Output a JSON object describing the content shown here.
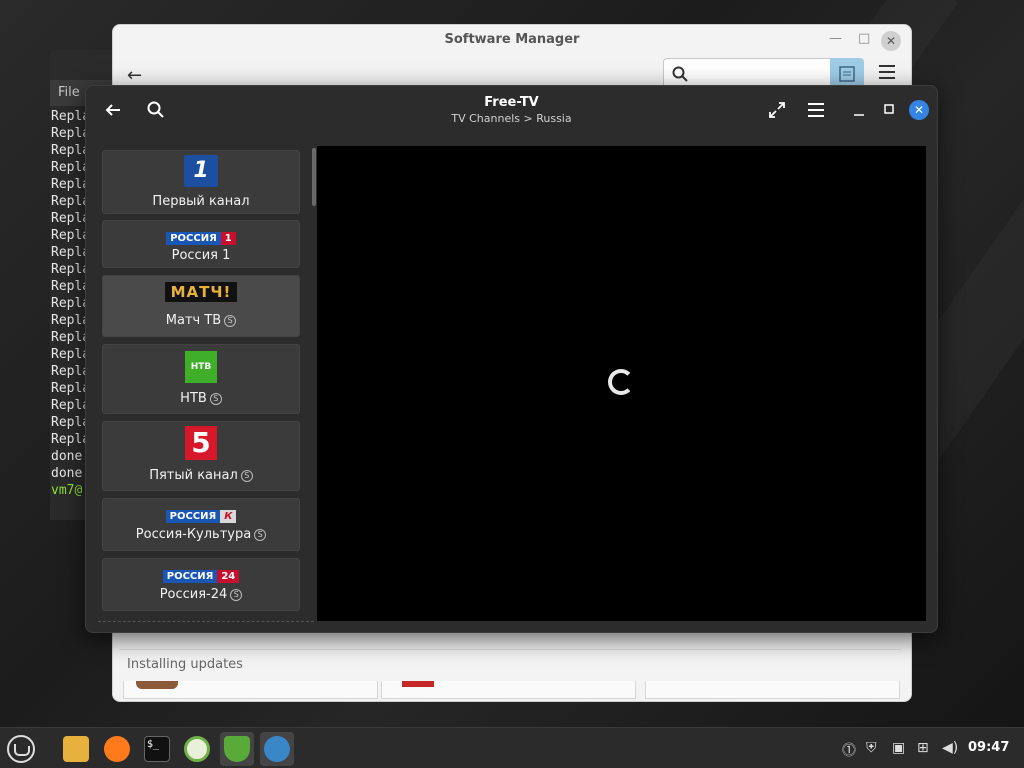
{
  "terminal": {
    "menu_label": "File",
    "lines": [
      "Repla",
      "Repla",
      "Repla",
      "Repla",
      "Repla",
      "Repla",
      "Repla",
      "Repla",
      "Repla",
      "Repla",
      "Repla",
      "Repla",
      "Repla",
      "Repla",
      "Repla",
      "Repla",
      "Repla",
      "Repla",
      "Repla",
      "Repla",
      "done",
      "done"
    ],
    "prompt": "vm7@"
  },
  "software_manager": {
    "title": "Software Manager",
    "status": "Installing updates"
  },
  "freetv": {
    "title": "Free-TV",
    "subtitle": "TV Channels > Russia",
    "channels": [
      {
        "name": "Первый канал",
        "logo_text": "1",
        "subscription": false
      },
      {
        "name": "Россия 1",
        "logo_text": "РОССИЯ",
        "logo_badge": "1",
        "subscription": false
      },
      {
        "name": "Матч ТВ",
        "logo_text": "МАТЧ!",
        "subscription": true,
        "subscription_mark": "S"
      },
      {
        "name": "НТВ",
        "logo_text": "НТВ",
        "subscription": true,
        "subscription_mark": "S"
      },
      {
        "name": "Пятый канал",
        "logo_text": "5",
        "subscription": true,
        "subscription_mark": "S"
      },
      {
        "name": "Россия-Культура",
        "logo_text": "РОССИЯ",
        "logo_badge": "К",
        "subscription": true,
        "subscription_mark": "S"
      },
      {
        "name": "Россия-24",
        "logo_text": "РОССИЯ",
        "logo_badge": "24",
        "subscription": true,
        "subscription_mark": "S"
      }
    ]
  },
  "taskbar": {
    "clock": "09:47",
    "apps": [
      "menu-icon",
      "files-icon",
      "firefox-icon",
      "terminal-icon",
      "software-manager-icon",
      "update-manager-icon",
      "freetv-icon"
    ],
    "tray": [
      "updates-icon",
      "shield-icon",
      "clipboard-icon",
      "network-icon",
      "volume-icon"
    ]
  },
  "colors": {
    "accent": "#3584e4",
    "mint_green": "#8ae234",
    "player_bg": "#000000"
  }
}
